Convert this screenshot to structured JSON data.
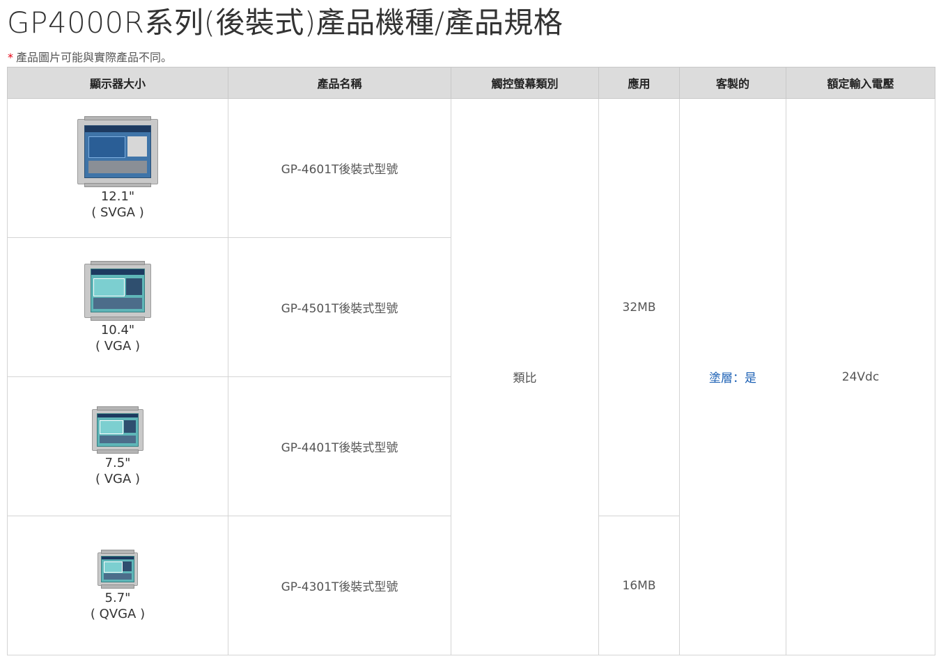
{
  "page": {
    "title": "GP4000R系列(後裝式)產品機種/產品規格",
    "note_asterisk": "*",
    "note": "產品圖片可能與實際產品不同。"
  },
  "table": {
    "headers": {
      "display_size": "顯示器大小",
      "product_name": "產品名稱",
      "touch_type": "觸控螢幕類別",
      "application": "應用",
      "customized": "客製的",
      "rated_voltage": "額定輸入電壓"
    },
    "rows": [
      {
        "size": "12.1\"",
        "resolution": "( SVGA )",
        "product": "GP-4601T後裝式型號",
        "icon": "hmi-panel-12-1-image"
      },
      {
        "size": "10.4\"",
        "resolution": "( VGA )",
        "product": "GP-4501T後裝式型號",
        "icon": "hmi-panel-10-4-image"
      },
      {
        "size": "7.5\"",
        "resolution": "( VGA )",
        "product": "GP-4401T後裝式型號",
        "icon": "hmi-panel-7-5-image"
      },
      {
        "size": "5.7\"",
        "resolution": "( QVGA )",
        "product": "GP-4301T後裝式型號",
        "icon": "hmi-panel-5-7-image"
      }
    ],
    "touch_type": "類比",
    "application_large": "32MB",
    "application_small": "16MB",
    "customized": "塗層：是",
    "rated_voltage": "24Vdc"
  },
  "colors": {
    "header_bg": "#dcdcdc",
    "link": "#1a5fb4",
    "asterisk": "#e60012"
  }
}
